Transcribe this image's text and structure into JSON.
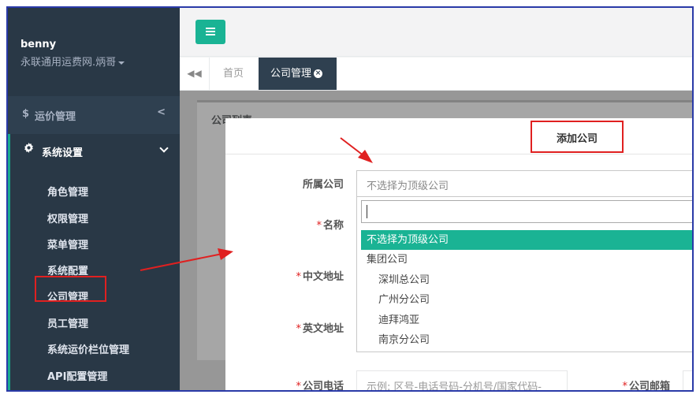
{
  "sidebar": {
    "user_name": "benny",
    "org_name": "永联通用运费网.炳哥",
    "price_menu": {
      "icon": "$",
      "label": "运价管理",
      "arrow": "<"
    },
    "settings_menu": {
      "label": "系统设置"
    },
    "sub_items": [
      "角色管理",
      "权限管理",
      "菜单管理",
      "系统配置",
      "公司管理",
      "员工管理",
      "系统运价栏位管理",
      "API配置管理"
    ]
  },
  "tabs": {
    "back": "◀◀",
    "home": "首页",
    "active": "公司管理",
    "close": "×"
  },
  "content": {
    "panel_title": "公司列表"
  },
  "modal": {
    "title": "添加公司",
    "fields": {
      "parent": "所属公司",
      "name": "名称",
      "cn_address": "中文地址",
      "en_address": "英文地址",
      "phone": "公司电话",
      "email": "公司邮箱"
    },
    "required_mark": "*",
    "select_value": "不选择为顶级公司",
    "options": [
      "不选择为顶级公司",
      "集团公司",
      "深圳总公司",
      "广州分公司",
      "迪拜鸿亚",
      "南京分公司"
    ],
    "phone_placeholder": "示例: 区号-电话号码-分机号/国家代码-"
  },
  "colors": {
    "accent": "#1ab394",
    "sidebar": "#2f4050",
    "annotation": "#e02020"
  }
}
